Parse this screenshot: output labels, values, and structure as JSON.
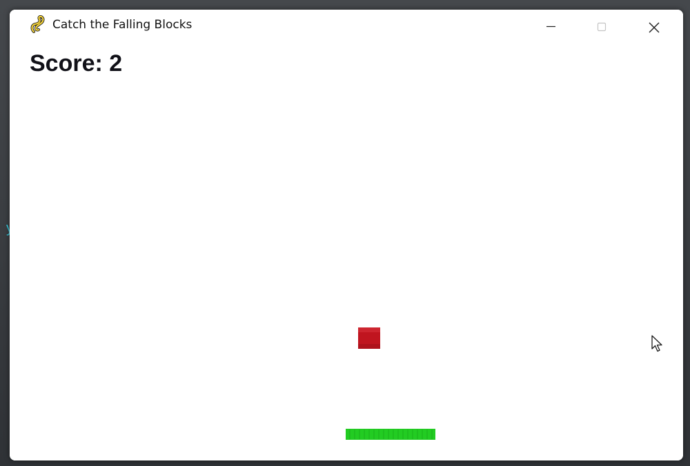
{
  "desktop": {
    "partial_glyph": "y"
  },
  "window": {
    "title": "Catch the Falling Blocks",
    "icon": "pygame-snake-icon",
    "controls": {
      "minimize_icon": "minimize-icon",
      "maximize_icon": "maximize-icon",
      "close_icon": "close-icon"
    }
  },
  "game": {
    "score_label": "Score: 2",
    "score": 2,
    "background_color": "#ffffff",
    "block_color": "#c0151f",
    "paddle_color": "#22cc22"
  },
  "cursor": {
    "icon": "arrow-cursor-icon"
  }
}
